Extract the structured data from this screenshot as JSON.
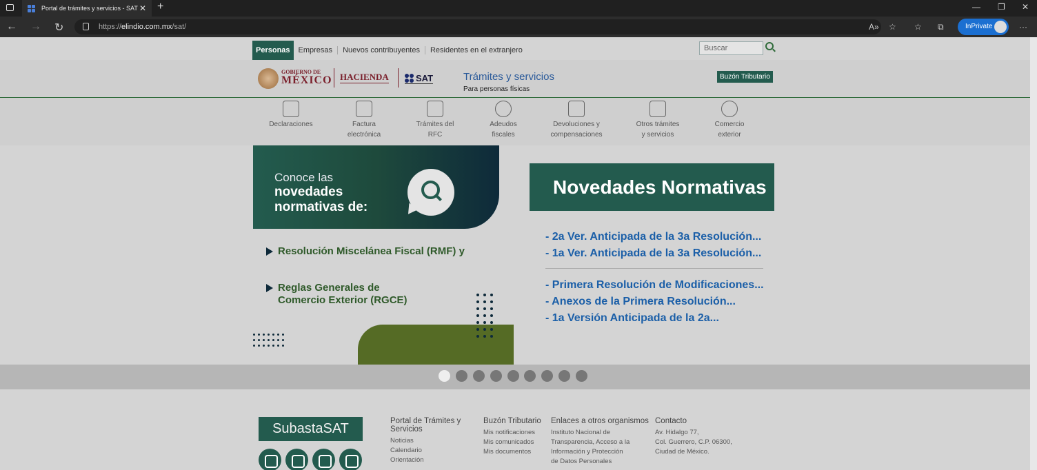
{
  "browser": {
    "tab_title": "Portal de trámites y servicios - SAT",
    "url_prefix": "https://",
    "url_host": "elindio.com.mx",
    "url_path": "/sat/",
    "inprivate_label": "InPrivate"
  },
  "topnav": {
    "active": "Personas",
    "items": [
      "Empresas",
      "Nuevos contribuyentes",
      "Residentes en el extranjero"
    ],
    "search_placeholder": "Buscar"
  },
  "header": {
    "gob_small": "GOBIERNO DE",
    "gob_big": "MÉXICO",
    "hacienda": "HACIENDA",
    "sat": "SAT",
    "title": "Trámites y servicios",
    "subtitle": "Para personas físicas",
    "buzon": "Buzón Tributario"
  },
  "categories": [
    {
      "l1": "Declaraciones",
      "l2": "",
      "icon": "declaraciones-icon"
    },
    {
      "l1": "Factura",
      "l2": "electrónica",
      "icon": "factura-icon"
    },
    {
      "l1": "Trámites del",
      "l2": "RFC",
      "icon": "rfc-icon"
    },
    {
      "l1": "Adeudos",
      "l2": "fiscales",
      "icon": "adeudos-icon"
    },
    {
      "l1": "Devoluciones y",
      "l2": "compensaciones",
      "icon": "devoluciones-icon"
    },
    {
      "l1": "Otros trámites",
      "l2": "y servicios",
      "icon": "otros-tramites-icon"
    },
    {
      "l1": "Comercio",
      "l2": "exterior",
      "icon": "comercio-exterior-icon"
    }
  ],
  "banner": {
    "line1": "Conoce las",
    "line2": "novedades normativas de:",
    "bullet1": "Resolución Miscelánea Fiscal (RMF) y",
    "bullet2a": "Reglas Generales de",
    "bullet2b": "Comercio Exterior (RGCE)",
    "box_title": "Novedades Normativas",
    "links_a": [
      "- 2a Ver. Anticipada de la 3a Resolución...",
      "- 1a Ver. Anticipada de la 3a Resolución..."
    ],
    "links_b": [
      "- Primera Resolución de Modificaciones...",
      "- Anexos de la Primera Resolución...",
      "- 1a Versión Anticipada de la 2a..."
    ]
  },
  "carousel": {
    "count": 9,
    "active_index": 0
  },
  "footer": {
    "subasta": "SubastaSAT",
    "col1": {
      "h": "Portal de Trámites y Servicios",
      "items": [
        "Noticias",
        "Calendario",
        "Orientación"
      ]
    },
    "col2": {
      "h": "Buzón Tributario",
      "items": [
        "Mis notificaciones",
        "Mis comunicados",
        "Mis documentos"
      ]
    },
    "col3": {
      "h": "Enlaces a otros organismos",
      "items": [
        "Instituto Nacional de",
        "Transparencia, Acceso a la",
        "Información y Protección",
        "de Datos Personales"
      ]
    },
    "col4": {
      "h": "Contacto",
      "items": [
        "Av. Hidalgo 77,",
        "Col. Guerrero, C.P. 06300,",
        "Ciudad de México."
      ]
    },
    "social": [
      "twitter-icon",
      "facebook-icon",
      "youtube-icon",
      "instagram-icon"
    ]
  }
}
